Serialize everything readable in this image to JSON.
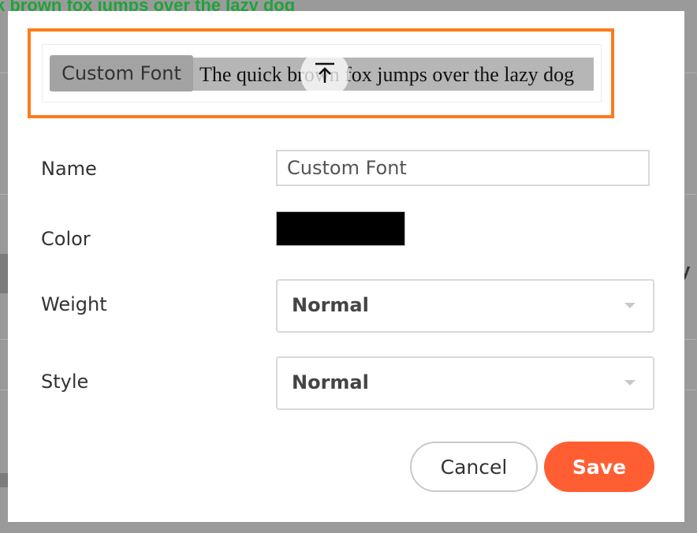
{
  "background": {
    "headline": "k brown fox jumps over the lazy dog",
    "side_text": "y"
  },
  "preview": {
    "tag": "Custom Font",
    "sample_text": "The quick brown fox jumps over the lazy dog",
    "highlight_color": "#ff7a1a",
    "upload_icon": "arrow-up-to-line-icon"
  },
  "form": {
    "name": {
      "label": "Name",
      "value": "Custom Font"
    },
    "color": {
      "label": "Color",
      "value": "#000000"
    },
    "weight": {
      "label": "Weight",
      "value": "Normal"
    },
    "style": {
      "label": "Style",
      "value": "Normal"
    }
  },
  "actions": {
    "cancel_label": "Cancel",
    "save_label": "Save",
    "save_color": "#ff5e33"
  }
}
